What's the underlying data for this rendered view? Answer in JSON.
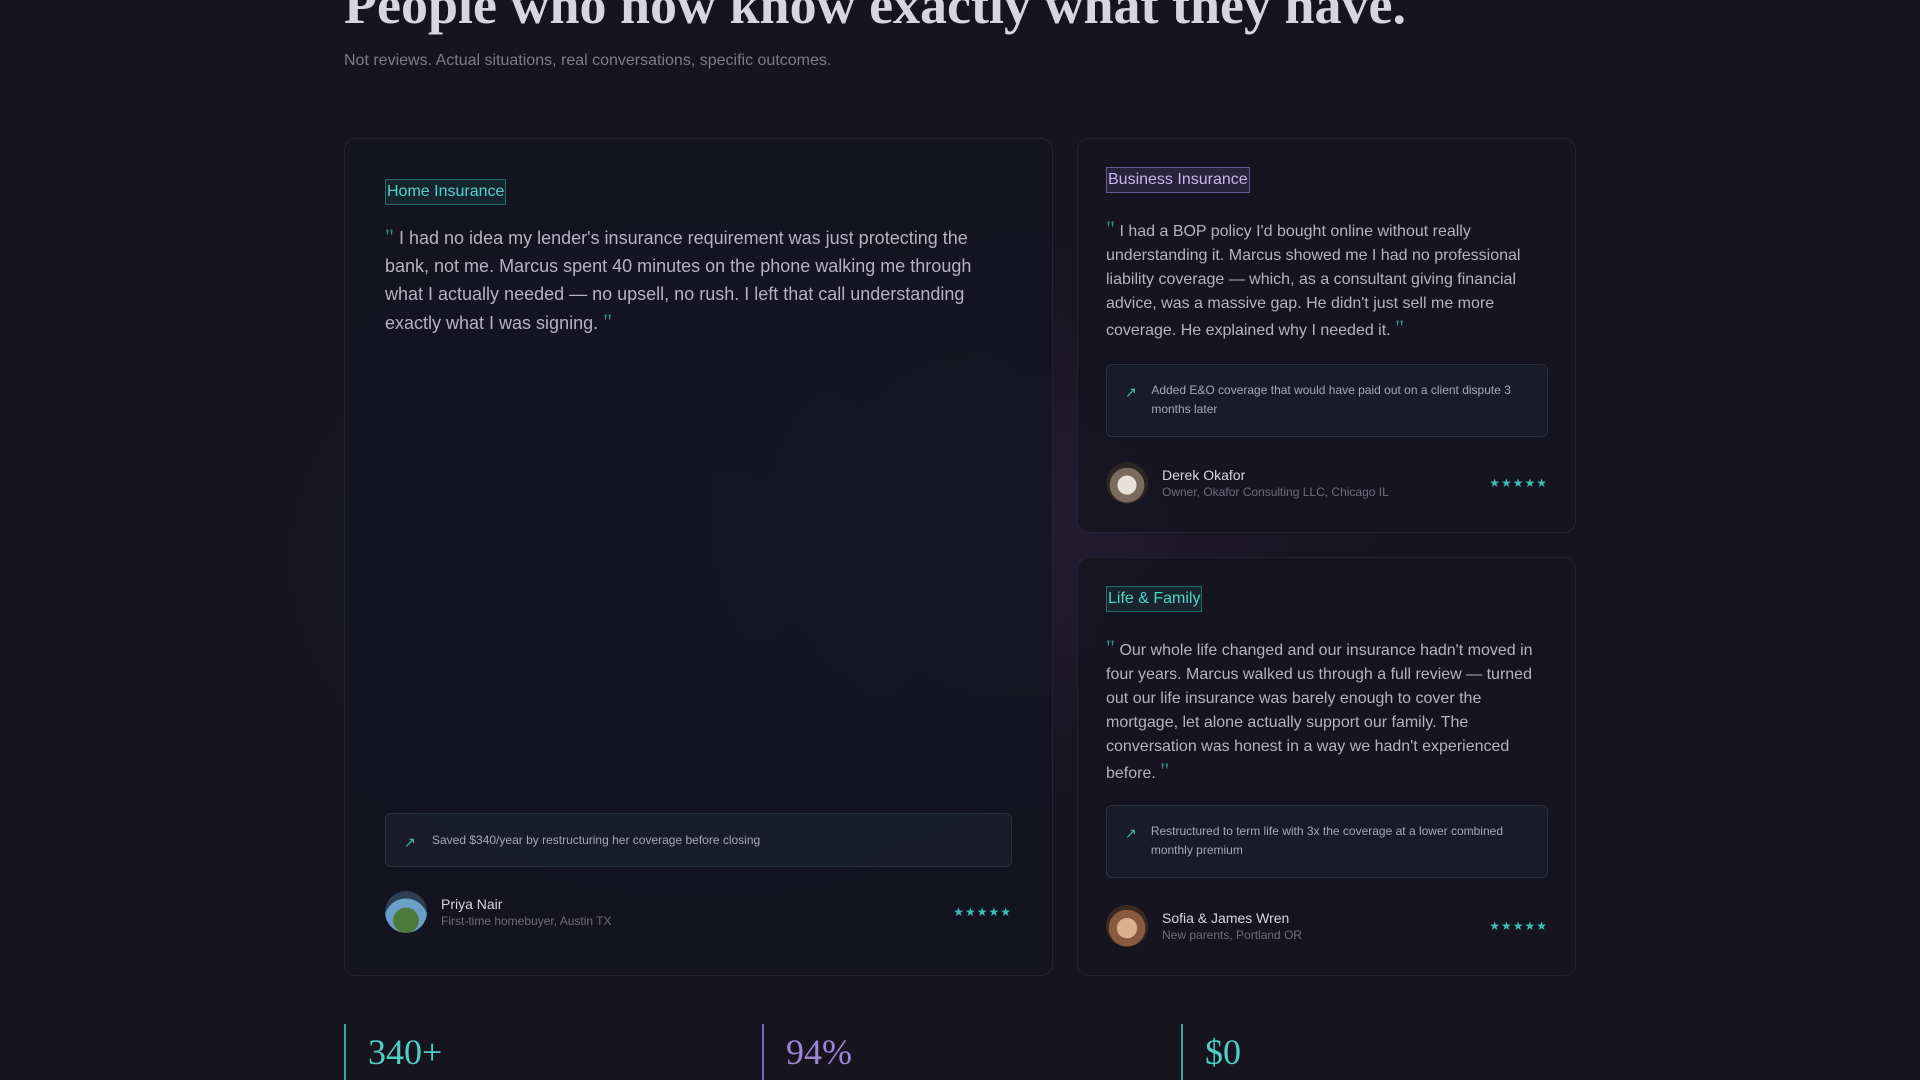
{
  "section": {
    "headline": "People who now know exactly what they have.",
    "subhead": "Not reviews. Actual situations, real conversations, specific outcomes."
  },
  "testimonials": [
    {
      "tag": "Home Insurance",
      "quote": "I had no idea my lender's insurance requirement was just protecting the bank, not me. Marcus spent 40 minutes on the phone walking me through what I actually needed — no upsell, no rush. I left that call understanding exactly what I was signing.",
      "outcome": "Saved $340/year by restructuring her coverage before closing",
      "name": "Priya Nair",
      "role": "First-time homebuyer, Austin TX",
      "rating": 5,
      "stars": "★★★★★"
    },
    {
      "tag": "Business Insurance",
      "quote": "I had a BOP policy I'd bought online without really understanding it. Marcus showed me I had no professional liability coverage — which, as a consultant giving financial advice, was a massive gap. He didn't just sell me more coverage. He explained why I needed it.",
      "outcome": "Added E&O coverage that would have paid out on a client dispute 3 months later",
      "name": "Derek Okafor",
      "role": "Owner, Okafor Consulting LLC, Chicago IL",
      "rating": 5,
      "stars": "★★★★★"
    },
    {
      "tag": "Life & Family",
      "quote": "Our whole life changed and our insurance hadn't moved in four years. Marcus walked us through a full review — turned out our life insurance was barely enough to cover the mortgage, let alone actually support our family. The conversation was honest in a way we hadn't experienced before.",
      "outcome": "Restructured to term life with 3x the coverage at a lower combined monthly premium",
      "name": "Sofia & James Wren",
      "role": "New parents, Portland OR",
      "rating": 5,
      "stars": "★★★★★"
    }
  ],
  "stats": [
    {
      "value": "340+"
    },
    {
      "value": "94%"
    },
    {
      "value": "$0"
    }
  ],
  "icons": {
    "quote_mark": "quote-icon",
    "outcome": "trending-up-icon",
    "rating": "star-icon"
  },
  "colors": {
    "accent_teal": "#4ed0c3",
    "accent_purple": "#9b86d0",
    "background": "#15141f"
  }
}
